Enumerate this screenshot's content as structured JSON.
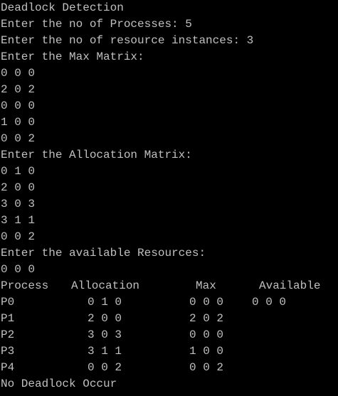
{
  "prompts": {
    "title": "Deadlock Detection",
    "processes": "Enter the no of Processes: 5",
    "instances": "Enter the no of resource instances: 3",
    "max_matrix": "Enter the Max Matrix:",
    "allocation_matrix": "Enter the Allocation Matrix:",
    "available": "Enter the available Resources:"
  },
  "max_input": [
    "0 0 0",
    "2 0 2",
    "0 0 0",
    "1 0 0",
    "0 0 2"
  ],
  "allocation_input": [
    "0 1 0",
    "2 0 0",
    "3 0 3",
    "3 1 1",
    "0 0 2"
  ],
  "available_input": "0 0 0",
  "table": {
    "headers": {
      "process": "Process",
      "allocation": "Allocation",
      "max": "Max",
      "available": "Available"
    },
    "rows": [
      {
        "process": "P0",
        "allocation": "0 1 0",
        "max": "0 0 0",
        "available": "0 0 0"
      },
      {
        "process": "P1",
        "allocation": "2 0 0",
        "max": "2 0 2",
        "available": ""
      },
      {
        "process": "P2",
        "allocation": "3 0 3",
        "max": "0 0 0",
        "available": ""
      },
      {
        "process": "P3",
        "allocation": "3 1 1",
        "max": "1 0 0",
        "available": ""
      },
      {
        "process": "P4",
        "allocation": "0 0 2",
        "max": "0 0 2",
        "available": ""
      }
    ]
  },
  "result": "No Deadlock Occur",
  "colors": {
    "background": "#000000",
    "text": "#c0c0c0"
  }
}
